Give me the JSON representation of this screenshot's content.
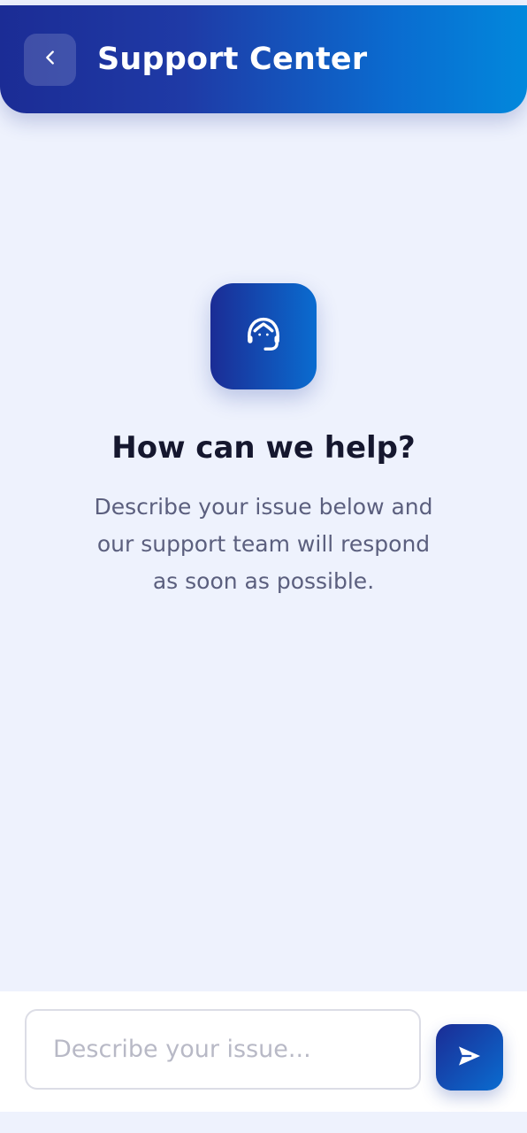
{
  "header": {
    "title": "Support Center",
    "back_icon": "chevron-left-icon"
  },
  "hero": {
    "icon": "headset-agent-icon",
    "title": "How can we help?",
    "description": "Describe your issue below and our support team will respond as soon as possible."
  },
  "composer": {
    "input_value": "",
    "input_placeholder": "Describe your issue...",
    "send_icon": "send-arrow-icon"
  },
  "colors": {
    "brand_dark": "#1b2c95",
    "brand_light": "#0288dc",
    "background": "#eef2fd",
    "title_text": "#15172e",
    "body_text": "#5b5f7e",
    "placeholder_text": "#b8b9c6"
  }
}
